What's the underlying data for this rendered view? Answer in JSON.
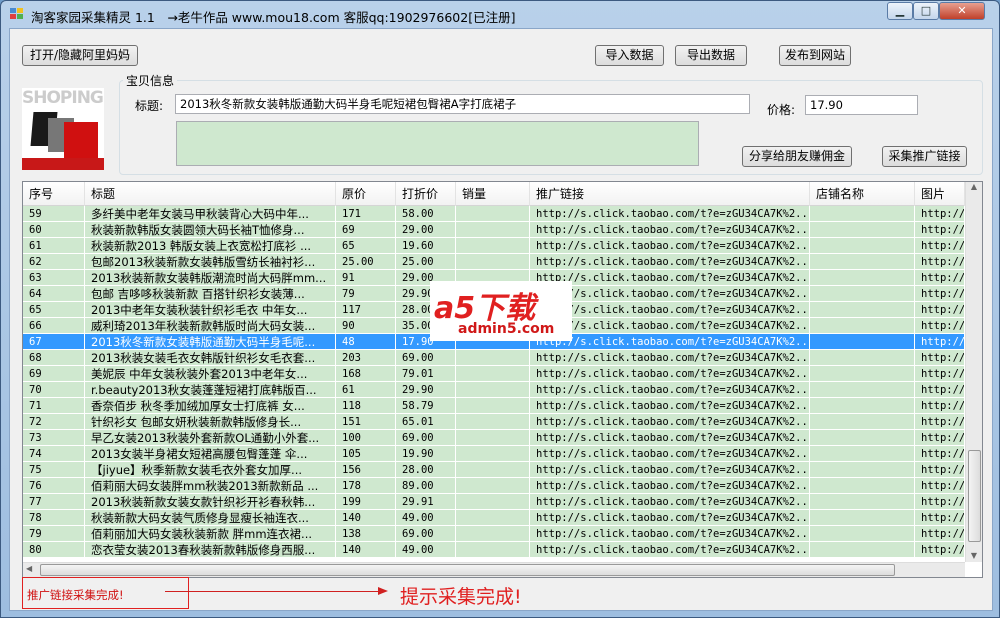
{
  "window": {
    "title": "淘客家园采集精灵 1.1　→老牛作品 www.mou18.com 客服qq:1902976602[已注册]"
  },
  "toolbar": {
    "toggle_alimama": "打开/隐藏阿里妈妈",
    "import": "导入数据",
    "export": "导出数据",
    "publish": "发布到网站"
  },
  "product": {
    "group_label": "宝贝信息",
    "title_label": "标题:",
    "title_value": "2013秋冬新款女装韩版通勤大码半身毛呢短裙包臀裙A字打底裙子",
    "price_label": "价格:",
    "price_value": "17.90",
    "image_text": "SHOPING",
    "share_button": "分享给朋友赚佣金",
    "collect_button": "采集推广链接"
  },
  "table": {
    "columns": [
      "序号",
      "标题",
      "原价",
      "打折价",
      "销量",
      "推广链接",
      "店铺名称",
      "图片"
    ],
    "rows": [
      [
        "59",
        "多纤美中老年女装马甲秋装背心大码中年...",
        "171",
        "58.00",
        "",
        "http://s.click.taobao.com/t?e=zGU34CA7K%2...",
        "",
        "http://"
      ],
      [
        "60",
        "秋装新款韩版女装圆领大码长袖T恤修身...",
        "69",
        "29.00",
        "",
        "http://s.click.taobao.com/t?e=zGU34CA7K%2...",
        "",
        "http://"
      ],
      [
        "61",
        "秋装新款2013 韩版女装上衣宽松打底衫 ...",
        "65",
        "19.60",
        "",
        "http://s.click.taobao.com/t?e=zGU34CA7K%2...",
        "",
        "http://"
      ],
      [
        "62",
        "包邮2013秋装新款女装韩版雪纺长袖衬衫...",
        "25.00",
        "25.00",
        "",
        "http://s.click.taobao.com/t?e=zGU34CA7K%2...",
        "",
        "http://"
      ],
      [
        "63",
        "2013秋装新款女装韩版潮流时尚大码胖mm...",
        "91",
        "29.00",
        "",
        "http://s.click.taobao.com/t?e=zGU34CA7K%2...",
        "",
        "http://"
      ],
      [
        "64",
        "包邮 吉哆哆秋装新款 百搭针织衫女装薄...",
        "79",
        "29.90",
        "",
        "http://s.click.taobao.com/t?e=zGU34CA7K%2...",
        "",
        "http://"
      ],
      [
        "65",
        "2013中老年女装秋装针织衫毛衣 中年女...",
        "117",
        "28.00",
        "",
        "http://s.click.taobao.com/t?e=zGU34CA7K%2...",
        "",
        "http://"
      ],
      [
        "66",
        "威利琦2013年秋装新款韩版时尚大码女装...",
        "90",
        "35.00",
        "",
        "http://s.click.taobao.com/t?e=zGU34CA7K%2...",
        "",
        "http://"
      ],
      [
        "67",
        "2013秋冬新款女装韩版通勤大码半身毛呢...",
        "48",
        "17.90",
        "",
        "http://s.click.taobao.com/t?e=zGU34CA7K%2...",
        "",
        "http://"
      ],
      [
        "68",
        "2013秋装女装毛衣女韩版针织衫女毛衣套...",
        "203",
        "69.00",
        "",
        "http://s.click.taobao.com/t?e=zGU34CA7K%2...",
        "",
        "http://"
      ],
      [
        "69",
        "美妮辰 中年女装秋装外套2013中老年女...",
        "168",
        "79.01",
        "",
        "http://s.click.taobao.com/t?e=zGU34CA7K%2...",
        "",
        "http://"
      ],
      [
        "70",
        "r.beauty2013秋女装蓬蓬短裙打底韩版百...",
        "61",
        "29.90",
        "",
        "http://s.click.taobao.com/t?e=zGU34CA7K%2...",
        "",
        "http://"
      ],
      [
        "71",
        "香奈佰步 秋冬季加绒加厚女士打底裤 女...",
        "118",
        "58.79",
        "",
        "http://s.click.taobao.com/t?e=zGU34CA7K%2...",
        "",
        "http://"
      ],
      [
        "72",
        "针织衫女 包邮女妍秋装新款韩版修身长...",
        "151",
        "65.01",
        "",
        "http://s.click.taobao.com/t?e=zGU34CA7K%2...",
        "",
        "http://"
      ],
      [
        "73",
        "早乙女装2013秋装外套新款OL通勤小外套...",
        "100",
        "69.00",
        "",
        "http://s.click.taobao.com/t?e=zGU34CA7K%2...",
        "",
        "http://"
      ],
      [
        "74",
        "2013女装半身裙女短裙高腰包臀蓬蓬 伞...",
        "105",
        "19.90",
        "",
        "http://s.click.taobao.com/t?e=zGU34CA7K%2...",
        "",
        "http://"
      ],
      [
        "75",
        "【jiyue】秋季新款女装毛衣外套女加厚...",
        "156",
        "28.00",
        "",
        "http://s.click.taobao.com/t?e=zGU34CA7K%2...",
        "",
        "http://"
      ],
      [
        "76",
        "佰莉丽大码女装胖mm秋装2013新款新品 ...",
        "178",
        "89.00",
        "",
        "http://s.click.taobao.com/t?e=zGU34CA7K%2...",
        "",
        "http://"
      ],
      [
        "77",
        "2013秋装新款女装女款针织衫开衫春秋韩...",
        "199",
        "29.91",
        "",
        "http://s.click.taobao.com/t?e=zGU34CA7K%2...",
        "",
        "http://"
      ],
      [
        "78",
        "秋装新款大码女装气质修身显瘦长袖连衣...",
        "140",
        "49.00",
        "",
        "http://s.click.taobao.com/t?e=zGU34CA7K%2...",
        "",
        "http://"
      ],
      [
        "79",
        "佰莉丽加大码女装秋装新款 胖mm连衣裙...",
        "138",
        "69.00",
        "",
        "http://s.click.taobao.com/t?e=zGU34CA7K%2...",
        "",
        "http://"
      ],
      [
        "80",
        "恋衣莹女装2013春秋装新款韩版修身西服...",
        "140",
        "49.00",
        "",
        "http://s.click.taobao.com/t?e=zGU34CA7K%2...",
        "",
        "http://"
      ]
    ],
    "selected_row": "67"
  },
  "status": {
    "message": "推广链接采集完成!",
    "annotation": "提示采集完成!"
  },
  "watermark": {
    "logo": "a5下载",
    "site": "admin5.com"
  }
}
